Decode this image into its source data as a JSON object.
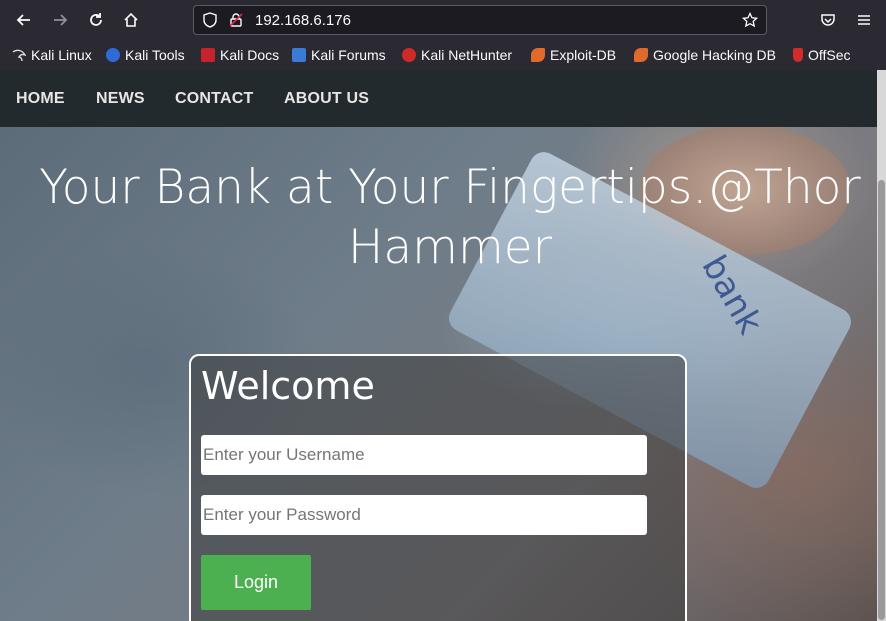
{
  "browser": {
    "url": "192.168.6.176",
    "bookmarks": [
      {
        "label": "Kali Linux",
        "icon": "kali-dragon-icon"
      },
      {
        "label": "Kali Tools",
        "icon": "kali-tools-icon"
      },
      {
        "label": "Kali Docs",
        "icon": "kali-docs-icon"
      },
      {
        "label": "Kali Forums",
        "icon": "kali-forums-icon"
      },
      {
        "label": "Kali NetHunter",
        "icon": "nethunter-icon"
      },
      {
        "label": "Exploit-DB",
        "icon": "exploit-db-icon"
      },
      {
        "label": "Google Hacking DB",
        "icon": "ghdb-icon"
      },
      {
        "label": "OffSec",
        "icon": "offsec-icon"
      }
    ]
  },
  "nav": {
    "items": [
      "HOME",
      "NEWS",
      "CONTACT",
      "ABOUT US"
    ]
  },
  "hero": {
    "title_line1": "Your Bank at Your Fingertips.@Thor",
    "title_line2": "Hammer",
    "card_word": "bank"
  },
  "login": {
    "heading": "Welcome",
    "username_placeholder": "Enter your Username",
    "password_placeholder": "Enter your Password",
    "button_label": "Login"
  },
  "colors": {
    "navbar": "#232a2e",
    "login_button": "#4caf50",
    "browser_chrome": "#2b2a33"
  }
}
